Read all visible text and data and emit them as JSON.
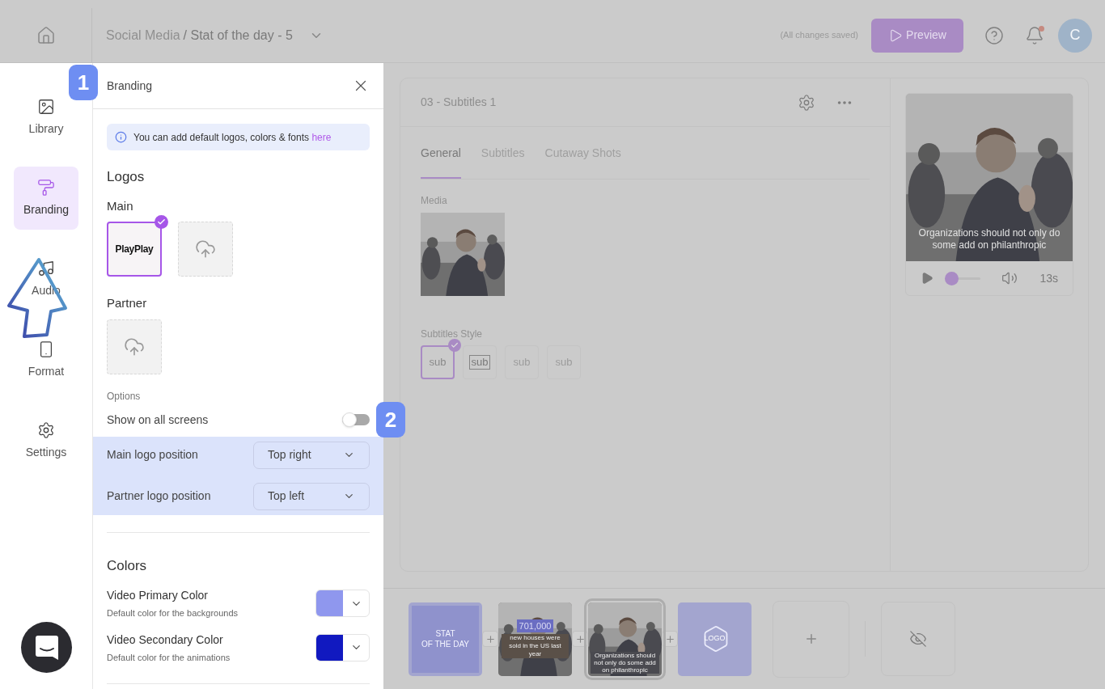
{
  "topbar": {
    "breadcrumb_parent": "Social Media",
    "breadcrumb_current": "/ Stat of the day - 5",
    "save_status": "(All changes saved)",
    "preview_button": "Preview",
    "avatar": "C",
    "unread": true
  },
  "nav": [
    {
      "label": "Library",
      "selected": false
    },
    {
      "label": "Branding",
      "selected": true
    },
    {
      "label": "Audio",
      "selected": false
    },
    {
      "label": "Format",
      "selected": false
    },
    {
      "label": "Settings",
      "selected": false
    }
  ],
  "tutorial_steps": [
    {
      "label": "1"
    },
    {
      "label": "2"
    }
  ],
  "panel": {
    "title": "Branding",
    "info": "You can add default logos, colors & fonts",
    "info_link": "here",
    "logos_heading": "Logos",
    "logo_groups": [
      {
        "label": "Main",
        "tiles": [
          {
            "kind": "logo",
            "text": "PlayPlay",
            "selected": true
          },
          {
            "kind": "upload",
            "selected": false
          }
        ]
      },
      {
        "label": "Partner",
        "tiles": [
          {
            "kind": "upload",
            "selected": false
          }
        ]
      }
    ],
    "options_label": "Options",
    "toggle": {
      "label": "Show on all screens",
      "on": false
    },
    "positions": [
      {
        "label": "Main logo position",
        "value": "Top right"
      },
      {
        "label": "Partner logo position",
        "value": "Top left"
      }
    ],
    "colors_heading": "Colors",
    "colors": [
      {
        "label": "Video Primary Color",
        "hint": "Default color for the backgrounds",
        "color": "#8f97ee"
      },
      {
        "label": "Video Secondary Color",
        "hint": "Default color for the animations",
        "color": "#1119c0"
      }
    ]
  },
  "editor": {
    "scene_title": "03 - Subtitles 1",
    "tabs": [
      {
        "label": "General",
        "selected": true
      },
      {
        "label": "Subtitles",
        "selected": false
      },
      {
        "label": "Cutaway Shots",
        "selected": false
      }
    ],
    "media_label": "Media",
    "style_label": "Subtitles Style",
    "styles": [
      {
        "label": "sub",
        "kind": "plain",
        "selected": true
      },
      {
        "label": "sub",
        "kind": "boxed",
        "selected": false
      },
      {
        "label": "sub",
        "kind": "faded",
        "selected": false
      },
      {
        "label": "sub",
        "kind": "faded",
        "selected": false
      }
    ]
  },
  "player": {
    "caption": "Organizations should not only do some add on philanthropic",
    "level": 0.1,
    "duration": "13s"
  },
  "timeline": [
    {
      "kind": "title",
      "text": "STAT\nOF THE DAY",
      "selected": false
    },
    {
      "kind": "stat",
      "figure": "701,000",
      "text": "new houses were sold in the US last year",
      "selected": false
    },
    {
      "kind": "video",
      "text": "Organizations should not only do some add on philanthropic",
      "selected": true
    },
    {
      "kind": "logo",
      "figure": "LOGO",
      "selected": false
    }
  ]
}
